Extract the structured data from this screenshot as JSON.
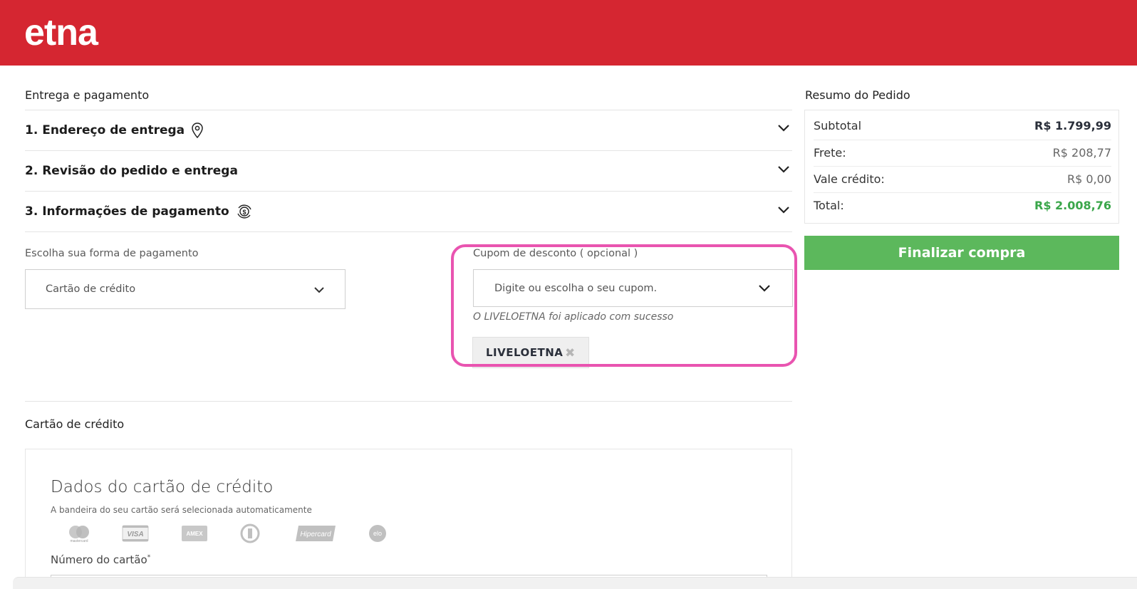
{
  "header": {
    "logo": "etna",
    "bg_color": "#d52631"
  },
  "checkout": {
    "title": "Entrega e pagamento",
    "steps": [
      {
        "label": "1. Endereço de entrega",
        "icon": "location-pin-icon"
      },
      {
        "label": "2. Revisão do pedido e entrega",
        "icon": ""
      },
      {
        "label": "3. Informações de pagamento",
        "icon": "payment-cycle-icon"
      }
    ],
    "payment": {
      "label": "Escolha sua forma de pagamento",
      "selected": "Cartão de crédito"
    },
    "coupon": {
      "label": "Cupom de desconto ( opcional )",
      "placeholder": "Digite ou escolha o seu cupom.",
      "success_message": "O LIVELOETNA foi aplicado com sucesso",
      "applied_code": "LIVELOETNA"
    },
    "credit_card_section": {
      "title": "Cartão de crédito",
      "panel_title": "Dados do cartão de crédito",
      "panel_subtitle": "A bandeira do seu cartão será selecionada automaticamente",
      "brands": [
        "mastercard",
        "VISA",
        "AMEX",
        "diners",
        "Hipercard",
        "elo"
      ],
      "number_label": "Número do cartão"
    }
  },
  "summary": {
    "title": "Resumo do Pedido",
    "rows": [
      {
        "label": "Subtotal",
        "value": "R$ 1.799,99"
      },
      {
        "label": "Frete:",
        "value": "R$ 208,77"
      },
      {
        "label": "Vale crédito:",
        "value": "R$ 0,00"
      },
      {
        "label": "Total:",
        "value": "R$ 2.008,76"
      }
    ],
    "total_color": "#3aa64a",
    "finalize_button": "Finalizar compra",
    "button_color": "#5cb85c"
  },
  "annotation": {
    "highlight_color": "#e954b0"
  }
}
